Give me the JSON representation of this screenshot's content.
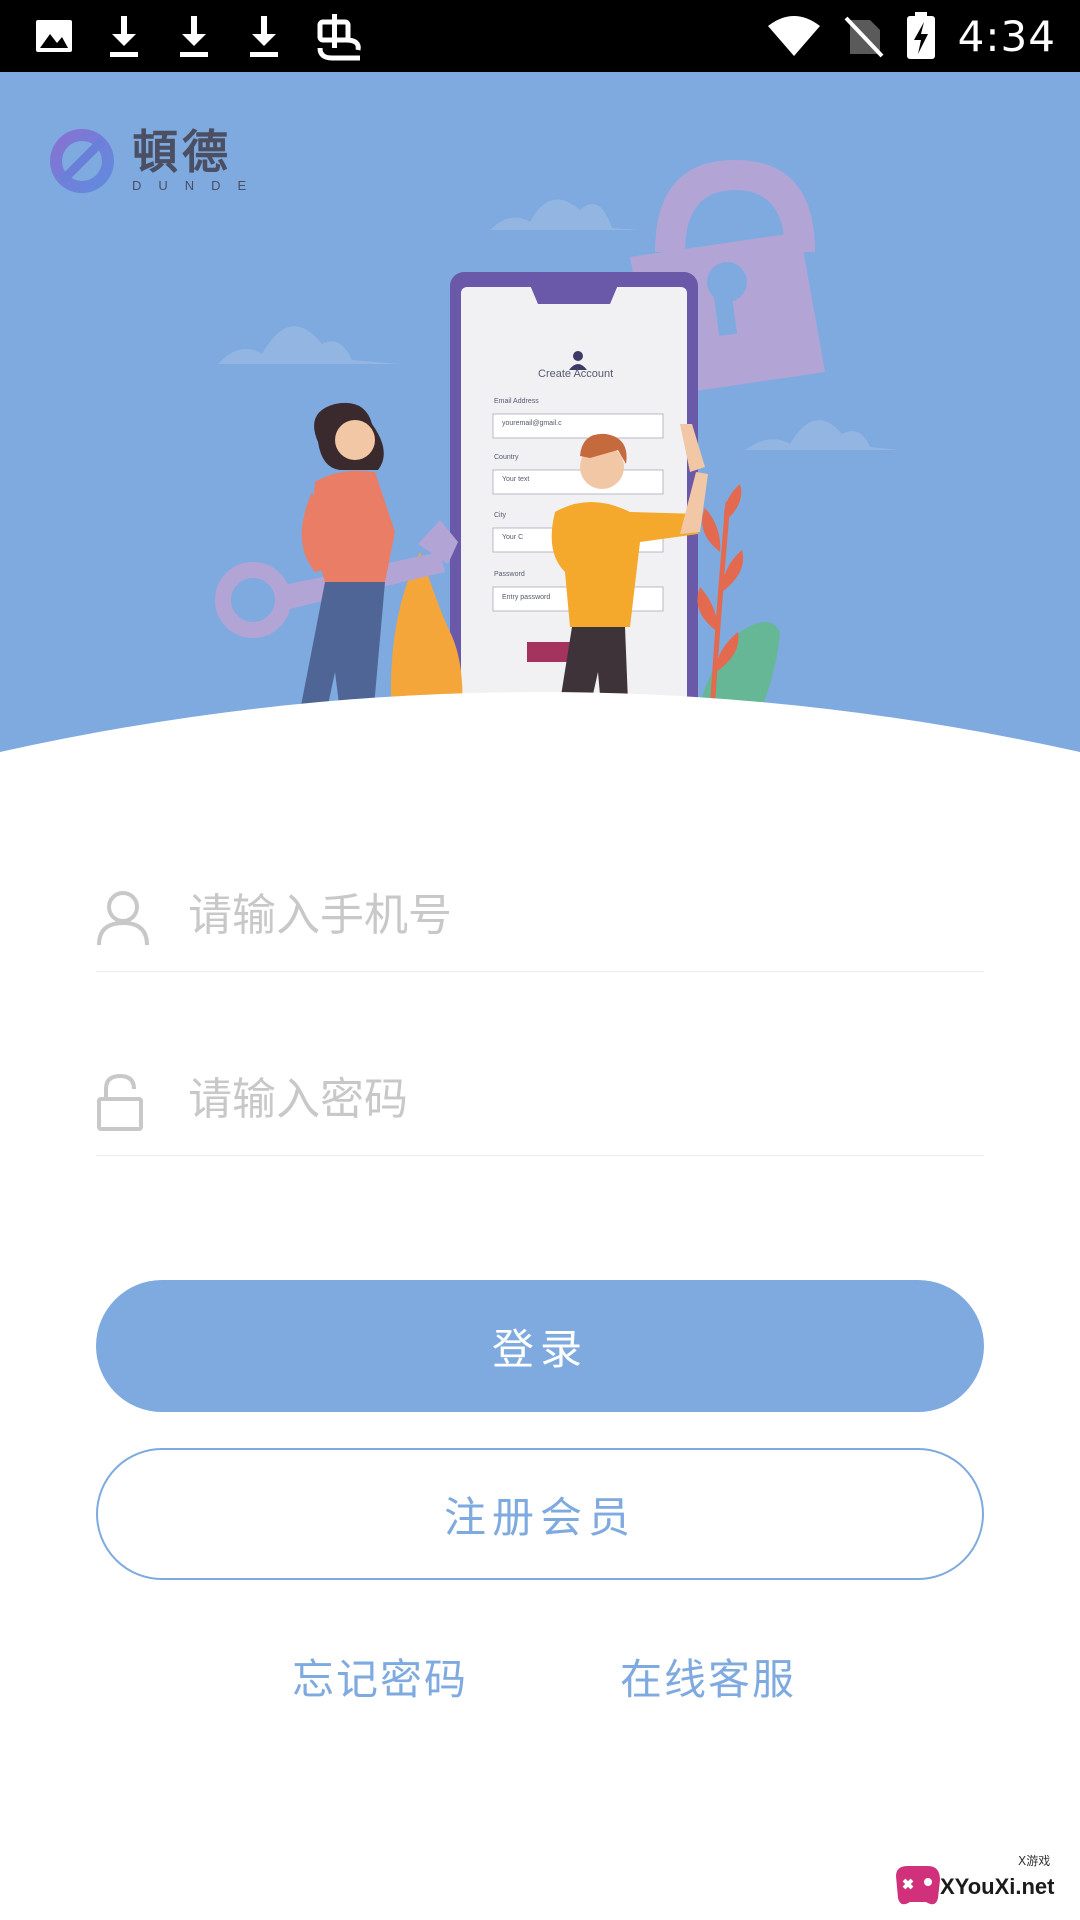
{
  "status_bar": {
    "time": "4:34",
    "icons_left": [
      "image-icon",
      "download-icon",
      "download-icon",
      "download-icon",
      "bug-icon"
    ],
    "icons_right": [
      "wifi-icon",
      "no-sim-icon",
      "battery-charging-icon"
    ]
  },
  "brand": {
    "name_cn": "頓德",
    "name_en": "DUNDE"
  },
  "illustration": {
    "phone_title": "Create Account",
    "email_label": "Email Address",
    "email_value": "youremail@gmail.c",
    "country_label": "Country",
    "country_value": "Your text",
    "city_label": "City",
    "city_value": "Your C",
    "password_label": "Password",
    "password_value": "Entry password"
  },
  "form": {
    "phone_placeholder": "请输入手机号",
    "password_placeholder": "请输入密码"
  },
  "buttons": {
    "login": "登录",
    "register": "注册会员"
  },
  "links": {
    "forgot_password": "忘记密码",
    "online_service": "在线客服"
  },
  "watermark": {
    "text": "XYouXi.net",
    "small": "X游戏"
  },
  "colors": {
    "accent": "#7eaadf",
    "status_bar": "#000000",
    "placeholder": "#c8c8c8"
  }
}
